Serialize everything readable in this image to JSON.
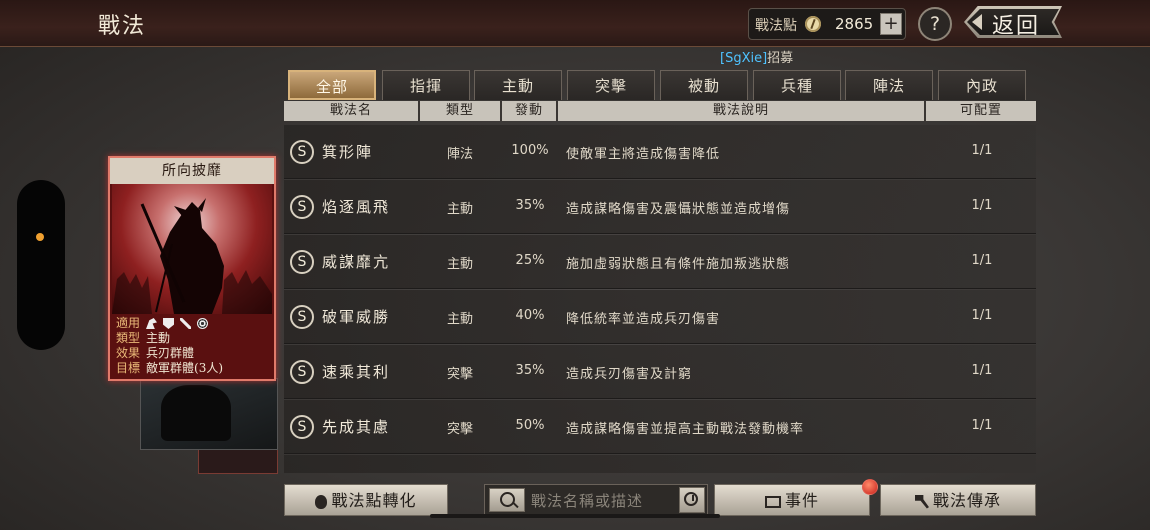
{
  "header": {
    "title": "戰法",
    "points_label": "戰法點",
    "points_value": "2865",
    "plus_label": "+",
    "help_label": "?",
    "back_label": "返回"
  },
  "recruit": {
    "tag": "[SgXie]",
    "text": "招募"
  },
  "card": {
    "name": "所向披靡",
    "rows": [
      {
        "key": "適用",
        "value": ""
      },
      {
        "key": "類型",
        "value": "主動"
      },
      {
        "key": "效果",
        "value": "兵刃群體"
      },
      {
        "key": "目標",
        "value": "敵軍群體(3人)"
      }
    ],
    "icons": [
      "horse-icon",
      "shield-icon",
      "sword-icon",
      "wheel-icon"
    ]
  },
  "tabs": [
    "全部",
    "指揮",
    "主動",
    "突擊",
    "被動",
    "兵種",
    "陣法",
    "內政"
  ],
  "active_tab": 0,
  "columns": [
    "戰法名",
    "類型",
    "發動",
    "戰法說明",
    "可配置"
  ],
  "rows": [
    {
      "grade": "S",
      "name": "箕形陣",
      "type": "陣法",
      "rate": "100%",
      "desc": "使敵軍主將造成傷害降低",
      "cfg": "1/1"
    },
    {
      "grade": "S",
      "name": "焰逐風飛",
      "type": "主動",
      "rate": "35%",
      "desc": "造成謀略傷害及震懾狀態並造成增傷",
      "cfg": "1/1"
    },
    {
      "grade": "S",
      "name": "威謀靡亢",
      "type": "主動",
      "rate": "25%",
      "desc": "施加虛弱狀態且有條件施加叛逃狀態",
      "cfg": "1/1"
    },
    {
      "grade": "S",
      "name": "破軍威勝",
      "type": "主動",
      "rate": "40%",
      "desc": "降低統率並造成兵刃傷害",
      "cfg": "1/1"
    },
    {
      "grade": "S",
      "name": "速乘其利",
      "type": "突擊",
      "rate": "35%",
      "desc": "造成兵刃傷害及計窮",
      "cfg": "1/1"
    },
    {
      "grade": "S",
      "name": "先成其慮",
      "type": "突擊",
      "rate": "50%",
      "desc": "造成謀略傷害並提高主動戰法發動機率",
      "cfg": "1/1"
    }
  ],
  "bottom": {
    "convert_label": "戰法點轉化",
    "search_placeholder": "戰法名稱或描述",
    "event_label": "事件",
    "inherit_label": "戰法傳承"
  },
  "colors": {
    "accent": "#c9a679",
    "tag": "#4fc3ff",
    "notify": "#c8201a"
  }
}
